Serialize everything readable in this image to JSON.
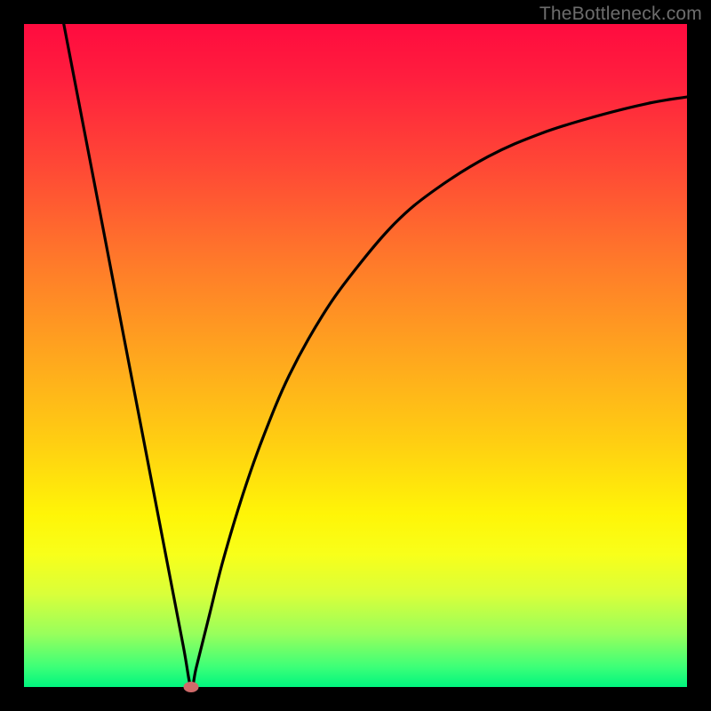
{
  "watermark": "TheBottleneck.com",
  "chart_data": {
    "type": "line",
    "title": "",
    "xlabel": "",
    "ylabel": "",
    "xlim": [
      0,
      100
    ],
    "ylim": [
      0,
      100
    ],
    "grid": false,
    "series": [
      {
        "name": "curve",
        "x": [
          6.0,
          9.0,
          12.0,
          15.0,
          18.0,
          21.0,
          24.0,
          25.2,
          26.0,
          28.0,
          30.0,
          33.0,
          36.0,
          40.0,
          45.0,
          50.0,
          56.0,
          62.0,
          70.0,
          78.0,
          86.0,
          94.0,
          100.0
        ],
        "y": [
          100.0,
          84.4,
          68.8,
          53.1,
          37.5,
          21.9,
          6.3,
          0.0,
          3.0,
          11.0,
          19.0,
          29.0,
          37.5,
          47.0,
          56.0,
          63.0,
          70.0,
          75.0,
          80.0,
          83.5,
          86.0,
          88.0,
          89.0
        ]
      }
    ],
    "min_point": {
      "x": 25.2,
      "y": 0.0
    },
    "background_gradient": {
      "top": "#ff0b3f",
      "mid_upper": "#ff7a2a",
      "mid": "#ffce12",
      "mid_lower": "#f8ff1a",
      "bottom": "#00f57e"
    }
  }
}
